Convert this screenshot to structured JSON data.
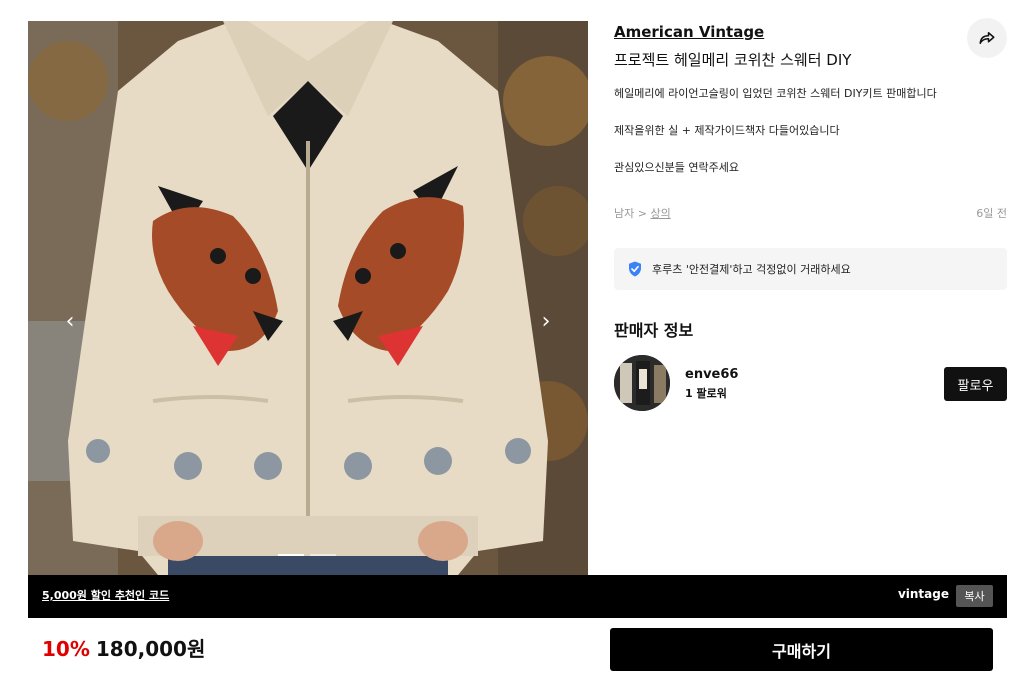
{
  "gallery": {
    "prev_icon": "chevron-left-icon",
    "next_icon": "chevron-right-icon",
    "dots_total": 2,
    "active_dot": 0
  },
  "product": {
    "brand": "American Vintage",
    "title": "프로젝트 헤일메리 코위찬 스웨터 DIY",
    "description": [
      "헤일메리에 라이언고슬링이 입었던 코위찬 스웨터  DIY키트 판매합니다",
      "제작을위한 실 + 제작가이드책자 다들어있습니다",
      "관심있으신분들 연락주세요"
    ],
    "category_prefix": "남자 > ",
    "category_link": "상의",
    "time_ago": "6일 전",
    "share_icon": "share-icon"
  },
  "safe_payment": {
    "text": "후루츠 '안전결제'하고 걱정없이 거래하세요",
    "icon": "shield-check-icon",
    "color": "#3b82f6"
  },
  "seller": {
    "heading": "판매자 정보",
    "name": "enve66",
    "followers": "1 팔로워",
    "follow_label": "팔로우"
  },
  "promo": {
    "link_text": "5,000원 할인 추천인 코드",
    "code": "vintage",
    "copy_label": "복사"
  },
  "purchase": {
    "discount": "10%",
    "price": "180,000원",
    "buy_label": "구매하기",
    "discount_color": "#e00000"
  }
}
